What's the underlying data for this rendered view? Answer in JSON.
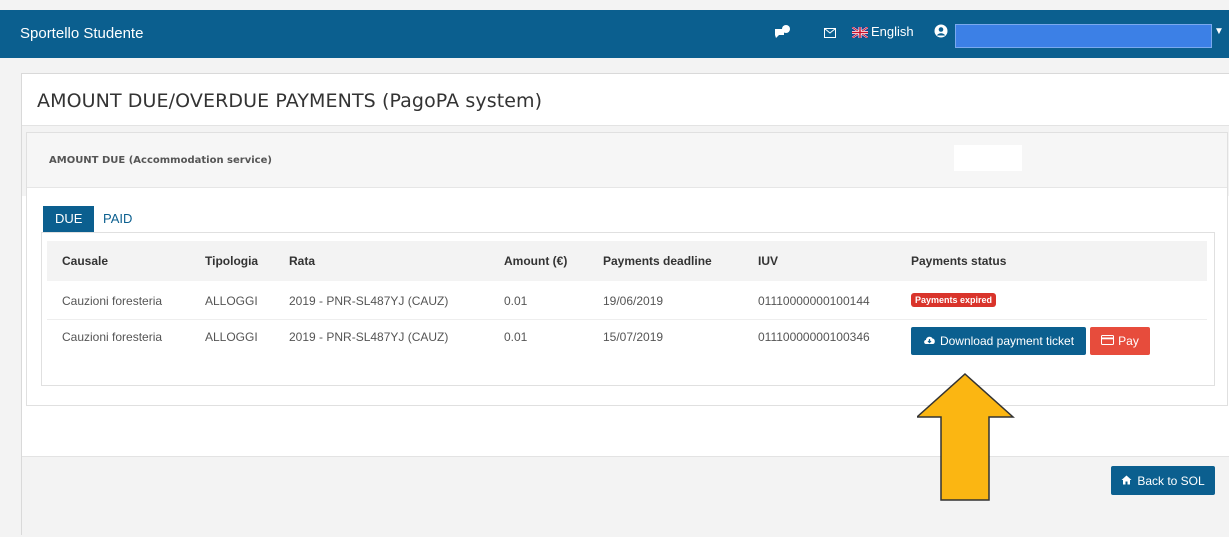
{
  "app": {
    "title": "Sportello Studente"
  },
  "topbar": {
    "language": "English",
    "notification_icon": "chat-bubble-icon",
    "mail_icon": "envelope-icon",
    "user_icon": "user-icon"
  },
  "page": {
    "title": "AMOUNT DUE/OVERDUE PAYMENTS (PagoPA system)"
  },
  "section": {
    "label": "AMOUNT DUE (Accommodation service)"
  },
  "tabs": [
    {
      "label": "DUE",
      "active": true
    },
    {
      "label": "PAID",
      "active": false
    }
  ],
  "table": {
    "columns": [
      "Causale",
      "Tipologia",
      "Rata",
      "Amount (€)",
      "Payments deadline",
      "IUV",
      "Payments status"
    ],
    "rows": [
      {
        "causale": "Cauzioni foresteria",
        "tipologia": "ALLOGGI",
        "rata": "2019 - PNR-SL487YJ (CAUZ)",
        "amount": "0.01",
        "deadline": "19/06/2019",
        "iuv": "01110000000100144",
        "status": "Payments expired"
      },
      {
        "causale": "Cauzioni foresteria",
        "tipologia": "ALLOGGI",
        "rata": "2019 - PNR-SL487YJ (CAUZ)",
        "amount": "0.01",
        "deadline": "15/07/2019",
        "iuv": "01110000000100346",
        "download_label": "Download payment ticket",
        "pay_label": "Pay"
      }
    ]
  },
  "footer": {
    "back_label": "Back to SOL"
  },
  "colors": {
    "primary": "#0b5f8f",
    "danger": "#d9342b",
    "pay": "#e74c3c",
    "arrow": "#fbb612"
  }
}
